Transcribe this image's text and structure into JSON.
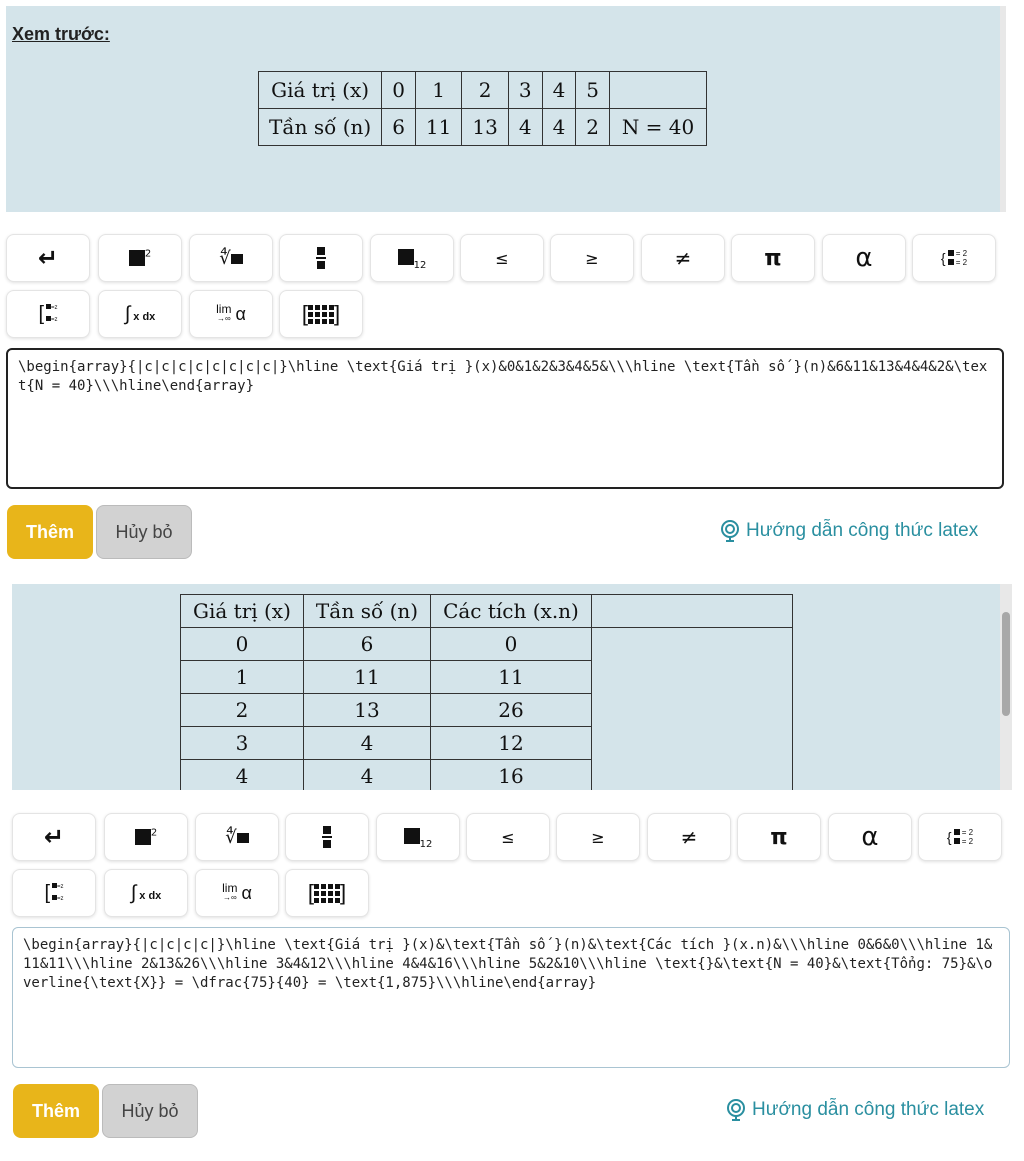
{
  "preview": {
    "title": "Xem trước:",
    "table1": {
      "row1": [
        "Giá trị (x)",
        "0",
        "1",
        "2",
        "3",
        "4",
        "5",
        ""
      ],
      "row2": [
        "Tần số (n)",
        "6",
        "11",
        "13",
        "4",
        "4",
        "2",
        "N = 40"
      ]
    },
    "table2": {
      "header": [
        "Giá trị (x)",
        "Tần số (n)",
        "Các tích (x.n)",
        ""
      ],
      "rows": [
        [
          "0",
          "6",
          "0"
        ],
        [
          "1",
          "11",
          "11"
        ],
        [
          "2",
          "13",
          "26"
        ],
        [
          "3",
          "4",
          "12"
        ],
        [
          "4",
          "4",
          "16"
        ]
      ]
    }
  },
  "toolbar": {
    "buttons": [
      "enter-icon",
      "superscript-icon",
      "nth-root-icon",
      "fraction-icon",
      "subscript-icon",
      "≤",
      "≥",
      "≠",
      "π",
      "α",
      "system-icon",
      "piecewise-icon",
      "integral-icon",
      "limit-icon",
      "matrix-icon"
    ],
    "labels": {
      "enter": "↵",
      "sup": "2",
      "sub": "12",
      "leq": "≤",
      "geq": "≥",
      "neq": "≠",
      "pi": "π",
      "alpha": "α",
      "system_top": "= 2",
      "system_bottom": "= 2",
      "piece_top": "=z",
      "piece_bottom": "=z",
      "integral": "∫",
      "integral_text": "x dx",
      "lim": "lim",
      "lim_sub": "→∞",
      "lim_alpha": "α"
    }
  },
  "editor1": {
    "value": "\\begin{array}{|c|c|c|c|c|c|c|c|}\\hline \\text{Giá trị }(x)&0&1&2&3&4&5&\\\\\\hline \\text{Tần số }(n)&6&11&13&4&4&2&\\text{N = 40}\\\\\\hline\\end{array}"
  },
  "editor2": {
    "value": "\\begin{array}{|c|c|c|c|}\\hline \\text{Giá trị }(x)&\\text{Tần số }(n)&\\text{Các tích }(x.n)&\\\\\\hline 0&6&0\\\\\\hline 1&11&11\\\\\\hline 2&13&26\\\\\\hline 3&4&12\\\\\\hline 4&4&16\\\\\\hline 5&2&10\\\\\\hline \\text{}&\\text{N = 40}&\\text{Tổng: 75}&\\overline{\\text{X}} = \\dfrac{75}{40} = \\text{1,875}\\\\\\hline\\end{array}"
  },
  "actions": {
    "add": "Thêm",
    "cancel": "Hủy bỏ",
    "help": "Hướng dẫn công thức latex"
  },
  "colors": {
    "preview_bg": "#d4e4ea",
    "add_button": "#e8b51a",
    "help_link": "#2a8fa0"
  }
}
